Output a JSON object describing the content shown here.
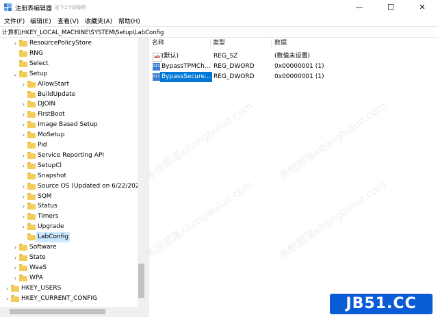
{
  "window": {
    "title": "注册表编辑器",
    "title_watermark": "@下1个好软件",
    "minimize_glyph": "—",
    "maximize_glyph": "☐",
    "close_glyph": "✕"
  },
  "menu": [
    "文件(F)",
    "编辑(E)",
    "查看(V)",
    "收藏夹(A)",
    "帮助(H)"
  ],
  "address": "计算机\\HKEY_LOCAL_MACHINE\\SYSTEM\\Setup\\LabConfig",
  "tree": [
    {
      "label": "ResourcePolicyStore",
      "level": 2,
      "chevron": "›"
    },
    {
      "label": "RNG",
      "level": 2,
      "chevron": ""
    },
    {
      "label": "Select",
      "level": 2,
      "chevron": ""
    },
    {
      "label": "Setup",
      "level": 2,
      "chevron": "⌄"
    },
    {
      "label": "AllowStart",
      "level": 3,
      "chevron": "›"
    },
    {
      "label": "BuildUpdate",
      "level": 3,
      "chevron": ""
    },
    {
      "label": "DJOIN",
      "level": 3,
      "chevron": "›"
    },
    {
      "label": "FirstBoot",
      "level": 3,
      "chevron": "›"
    },
    {
      "label": "Image Based Setup",
      "level": 3,
      "chevron": "›"
    },
    {
      "label": "MoSetup",
      "level": 3,
      "chevron": "›"
    },
    {
      "label": "Pid",
      "level": 3,
      "chevron": ""
    },
    {
      "label": "Service Reporting API",
      "level": 3,
      "chevron": "›"
    },
    {
      "label": "SetupCl",
      "level": 3,
      "chevron": "›"
    },
    {
      "label": "Snapshot",
      "level": 3,
      "chevron": ""
    },
    {
      "label": "Source OS (Updated on 6/22/202",
      "level": 3,
      "chevron": "›"
    },
    {
      "label": "SQM",
      "level": 3,
      "chevron": "›"
    },
    {
      "label": "Status",
      "level": 3,
      "chevron": "›"
    },
    {
      "label": "Timers",
      "level": 3,
      "chevron": "›"
    },
    {
      "label": "Upgrade",
      "level": 3,
      "chevron": "›"
    },
    {
      "label": "LabConfig",
      "level": 3,
      "chevron": "",
      "selected": true
    },
    {
      "label": "Software",
      "level": 2,
      "chevron": "›"
    },
    {
      "label": "State",
      "level": 2,
      "chevron": "›"
    },
    {
      "label": "WaaS",
      "level": 2,
      "chevron": "›"
    },
    {
      "label": "WPA",
      "level": 2,
      "chevron": "›"
    },
    {
      "label": "HKEY_USERS",
      "level": 0,
      "chevron": "›"
    },
    {
      "label": "HKEY_CURRENT_CONFIG",
      "level": 0,
      "chevron": "›"
    }
  ],
  "list": {
    "headers": {
      "name": "名称",
      "type": "类型",
      "data": "数据"
    },
    "rows": [
      {
        "icon": "ab",
        "name": "(默认)",
        "type": "REG_SZ",
        "data": "(数值未设置)",
        "selected": false
      },
      {
        "icon": "bin",
        "name": "BypassTPMCh...",
        "type": "REG_DWORD",
        "data": "0x00000001 (1)",
        "selected": false
      },
      {
        "icon": "bin",
        "name": "BypassSecure...",
        "type": "REG_DWORD",
        "data": "0x00000001 (1)",
        "selected": true
      }
    ]
  },
  "watermark_text": "系统部落xitongbuluo.com",
  "brand": "JB51.CC",
  "colors": {
    "selection": "#0078d7",
    "tree_selection": "#cce8ff",
    "brand": "#0a5bd6",
    "folder": "#f4cc5a"
  }
}
